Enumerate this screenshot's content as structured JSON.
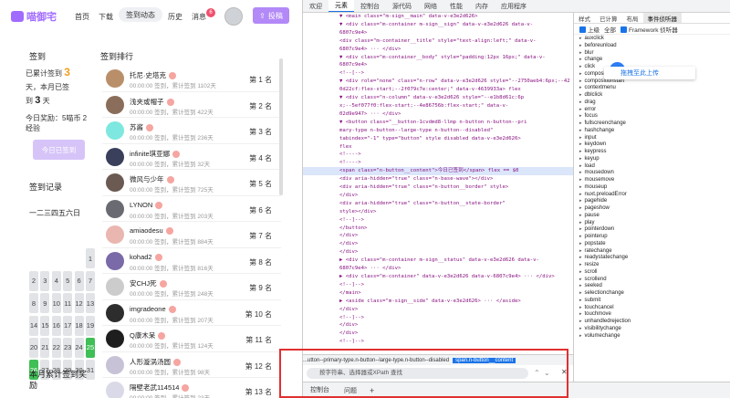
{
  "site": {
    "logo": "喵御宅",
    "nav": [
      "首页",
      "下载",
      "签到",
      "动态",
      "历史",
      "消息"
    ],
    "message_count": "6",
    "post_button": "投稿"
  },
  "sign": {
    "title": "签到",
    "line1": "已累计签到",
    "total_days": "3",
    "line2": "天，本月已签",
    "line3": "到",
    "month_days": "3",
    "line4": "天",
    "reward": "今日奖励：5喵币 2经验",
    "button": "今日已签到"
  },
  "rank": {
    "title": "签到排行",
    "rows": [
      {
        "name": "托尼·史塔克",
        "meta": "00:00:00 签到，累计签到 1102天",
        "no": "第 1 名",
        "color": "#b98f6a"
      },
      {
        "name": "浅夹或帽子",
        "meta": "00:00:00 签到，累计签到 422天",
        "no": "第 2 名",
        "color": "#8a6d5a"
      },
      {
        "name": "苏酱",
        "meta": "00:00:00 签到，累计签到 236天",
        "no": "第 3 名",
        "color": "#7ee8e0"
      },
      {
        "name": "infinite琪亚娜",
        "meta": "00:00:00 签到，累计签到 32天",
        "no": "第 4 名",
        "color": "#3a3f5c"
      },
      {
        "name": "微风与少年",
        "meta": "00:00:00 签到，累计签到 725天",
        "no": "第 5 名",
        "color": "#6b5a52"
      },
      {
        "name": "LYNON",
        "meta": "00:00:00 签到，累计签到 203天",
        "no": "第 6 名",
        "color": "#6a6a72"
      },
      {
        "name": "amiaodesu",
        "meta": "00:00:00 签到，累计签到 884天",
        "no": "第 7 名",
        "color": "#e9b7b0"
      },
      {
        "name": "kohad2",
        "meta": "00:00:00 签到，累计签到 816天",
        "no": "第 8 名",
        "color": "#7a6aa8"
      },
      {
        "name": "安CHJ死",
        "meta": "00:00:00 签到，累计签到 248天",
        "no": "第 9 名",
        "color": "#cccccc"
      },
      {
        "name": "imgradeone",
        "meta": "00:00:00 签到，累计签到 207天",
        "no": "第 10 名",
        "color": "#2d2d2d"
      },
      {
        "name": "Q康木呆",
        "meta": "00:00:00 签到，累计签到 124天",
        "no": "第 11 名",
        "color": "#1e1e1e"
      },
      {
        "name": "人形漩涡汤圆",
        "meta": "00:00:00 签到，累计签到 98天",
        "no": "第 12 名",
        "color": "#c7c2d6"
      },
      {
        "name": "隔壁老武114514",
        "meta": "00:00:00 签到，累计签到 23天",
        "no": "第 13 名",
        "color": "#d9d9e8"
      }
    ]
  },
  "calendar": {
    "title": "签到记录",
    "weekdays": "一二三四五六日",
    "days": [
      "",
      "",
      "",
      "",
      "",
      "",
      "",
      "",
      "",
      "",
      "",
      "1",
      "2",
      "3",
      "4",
      "5",
      "6",
      "7",
      "8",
      "9",
      "10",
      "11",
      "12",
      "13",
      "14",
      "15",
      "16",
      "17",
      "18",
      "19",
      "20",
      "21",
      "22",
      "23",
      "24",
      "25",
      "26",
      "27",
      "28",
      "29",
      "30",
      "31"
    ],
    "checked": [
      "25",
      "26"
    ]
  },
  "month_title": "本月累计签到奖励",
  "devtools": {
    "tabs": [
      "欢迎",
      "元素",
      "控制台",
      "源代码",
      "网络",
      "性能",
      "内存",
      "应用程序"
    ],
    "active_tab": "元素",
    "dom_lines": [
      "▼ <main class=\"m-sign__main\" data-v-e3e2d626>",
      "  ▼ <div class=\"m-container m-sign__sign\" data-v-e3e2d626 data-v-",
      "    6807c9e4>",
      "    <div class=\"m-container__title\" style=\"text-align:left;\" data-v-",
      "    6807c9e4> ··· </div>",
      "    ▼ <div class=\"m-container__body\" style=\"padding:12px 16px;\" data-v-",
      "      6807c9e4>",
      "      <!--[-->",
      "      ▼ <div role=\"none\" class=\"n-row\" data-v-e3e2d626 style=\"--2750aeb4:6px;--42",
      "        0d22cf:flex-start;--2f079c7e:center;\" data-v-4639933a> flex",
      "        ▼ <div class=\"n-column\" data-v-e3e2d626 style=\"--e1b8d61c:6p",
      "          x;--5ef077f0:flex-start;--4e86756b:flex-start;\" data-v-",
      "          02d9e947> ··· </div>",
      "        ▼ <button class=\"__button-1cvdmd8-llmp n-button n-button--pri",
      "          mary-type n-button--large-type n-button--disabled\"",
      "          tabindex=\"-1\" type=\"button\" style disabled data-v-e3e2d626>",
      "          flex",
      "          <!---->",
      "          <!---->",
      "          <span class=\"n-button__content\">今日已签到</span> flex == $0",
      "          <div aria-hidden=\"true\" class=\"n-base-wave\"></div>",
      "          <div aria-hidden=\"true\" class=\"n-button__border\" style>",
      "          </div>",
      "          <div aria-hidden=\"true\" class=\"n-button__state-border\"",
      "          style></div>",
      "          <!--]-->",
      "        </button>",
      "      </div>",
      "    </div>",
      "  </div>",
      "  ▶ <div class=\"m-container m-sign__status\" data-v-e3e2d626 data-v-",
      "    6807c9e4> ··· </div>",
      "  ▶ <div class=\"m-container\" data-v-e3e2d626 data-v-6807c9e4> ··· </div>",
      "  <!--]-->",
      "</main>",
      "▶ <aside class=\"m-sign__side\" data-v-e3e2d626> ··· </aside>",
      "</div>",
      "<!--]-->",
      "</div>",
      "</div>",
      "<!--]-->"
    ],
    "selected_line": 19,
    "breadcrumb": "...utton--primary-type.n-button--large-type.n-button--disabled",
    "breadcrumb_active": "span.n-button__content",
    "find_placeholder": "按字符串、选择器或XPath 查找",
    "drawer_tabs": [
      "控制台",
      "问题"
    ],
    "side_tabs": [
      "样式",
      "已计算",
      "布局",
      "事件侦听器"
    ],
    "side_active": "事件侦听器",
    "filter": [
      "上级",
      "全部",
      "Framework 侦听器"
    ],
    "events": [
      "auxclick",
      "beforeunload",
      "blur",
      "change",
      "click",
      "compositionend",
      "compositionstart",
      "contextmenu",
      "dblclick",
      "drag",
      "error",
      "focus",
      "fullscreenchange",
      "hashchange",
      "input",
      "keydown",
      "keypress",
      "keyup",
      "load",
      "mousedown",
      "mousemove",
      "mouseup",
      "nuxt.preloadError",
      "pagehide",
      "pageshow",
      "pause",
      "play",
      "pointerdown",
      "pointerup",
      "popstate",
      "ratechange",
      "readystatechange",
      "resize",
      "scroll",
      "scrollend",
      "seeked",
      "selectionchange",
      "submit",
      "touchcancel",
      "touchmove",
      "unhandledrejection",
      "visibilitychange",
      "volumechange"
    ],
    "overlay_label": "拖拽至此上传"
  }
}
